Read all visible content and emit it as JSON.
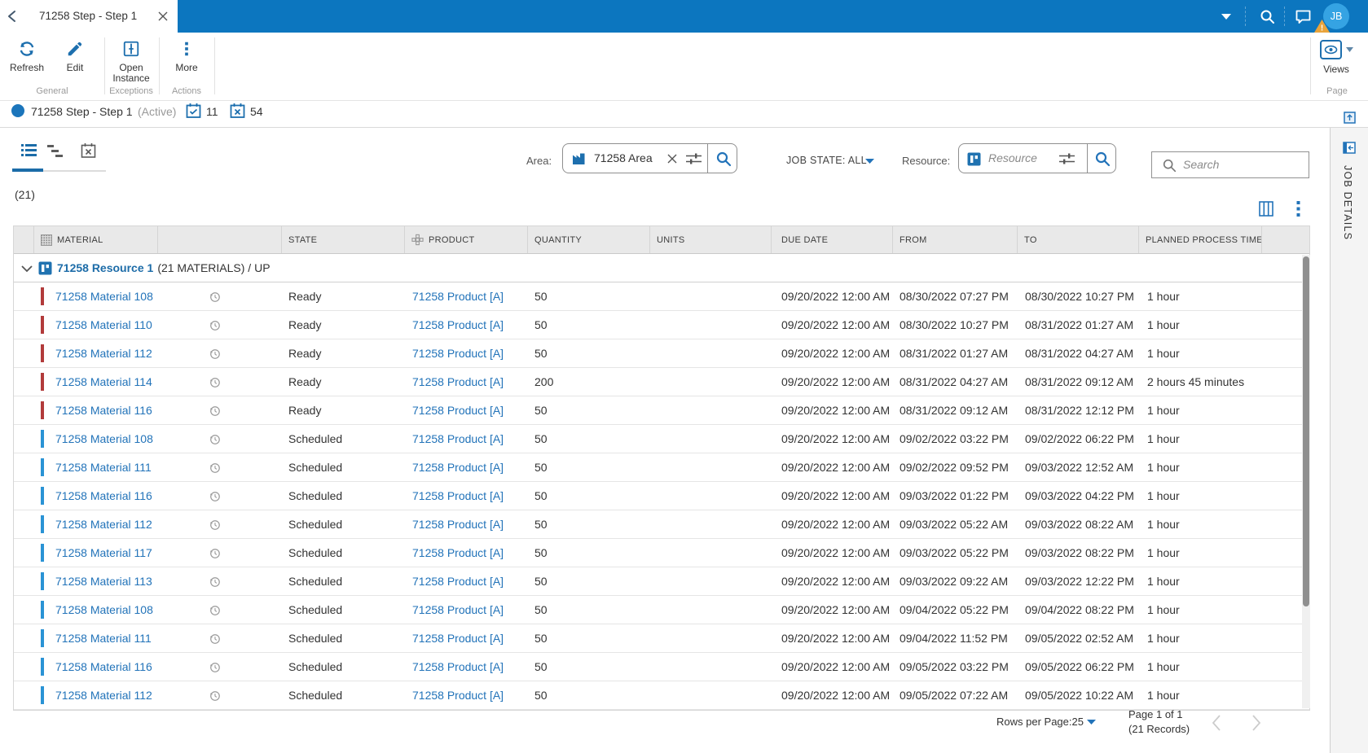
{
  "topbar": {
    "tab_title": "71258 Step - Step 1",
    "avatar_initials": "JB"
  },
  "ribbon": {
    "refresh_label": "Refresh",
    "edit_label": "Edit",
    "open_instance_label": "Open Instance",
    "more_label": "More",
    "views_label": "Views",
    "groups": {
      "general": "General",
      "exceptions": "Exceptions",
      "actions": "Actions",
      "page": "Page"
    }
  },
  "statusbar": {
    "title": "71258 Step - Step 1",
    "state": "(Active)",
    "scheduled_count": "11",
    "unscheduled_count": "54"
  },
  "filters": {
    "area_label": "Area:",
    "area_value": "71258 Area",
    "job_state": "JOB STATE: ALL",
    "resource_label": "Resource:",
    "resource_placeholder": "Resource",
    "search_placeholder": "Search"
  },
  "grid": {
    "count": "(21)",
    "columns": [
      "",
      "MATERIAL",
      "",
      "STATE",
      "PRODUCT",
      "QUANTITY",
      "UNITS",
      "DUE DATE",
      "FROM",
      "TO",
      "PLANNED PROCESS TIME",
      ""
    ],
    "group": {
      "name": "71258 Resource 1",
      "suffix": "(21 MATERIALS) / UP"
    },
    "rows": [
      {
        "material": "71258 Material 108",
        "state": "Ready",
        "product": "71258 Product [A]",
        "quantity": "50",
        "units": "",
        "due": "09/20/2022 12:00 AM",
        "from": "08/30/2022 07:27 PM",
        "to": "08/30/2022 10:27 PM",
        "planned": "1 hour",
        "bar": "red"
      },
      {
        "material": "71258 Material 110",
        "state": "Ready",
        "product": "71258 Product [A]",
        "quantity": "50",
        "units": "",
        "due": "09/20/2022 12:00 AM",
        "from": "08/30/2022 10:27 PM",
        "to": "08/31/2022 01:27 AM",
        "planned": "1 hour",
        "bar": "red"
      },
      {
        "material": "71258 Material 112",
        "state": "Ready",
        "product": "71258 Product [A]",
        "quantity": "50",
        "units": "",
        "due": "09/20/2022 12:00 AM",
        "from": "08/31/2022 01:27 AM",
        "to": "08/31/2022 04:27 AM",
        "planned": "1 hour",
        "bar": "red"
      },
      {
        "material": "71258 Material 114",
        "state": "Ready",
        "product": "71258 Product [A]",
        "quantity": "200",
        "units": "",
        "due": "09/20/2022 12:00 AM",
        "from": "08/31/2022 04:27 AM",
        "to": "08/31/2022 09:12 AM",
        "planned": "2 hours 45 minutes",
        "bar": "red"
      },
      {
        "material": "71258 Material 116",
        "state": "Ready",
        "product": "71258 Product [A]",
        "quantity": "50",
        "units": "",
        "due": "09/20/2022 12:00 AM",
        "from": "08/31/2022 09:12 AM",
        "to": "08/31/2022 12:12 PM",
        "planned": "1 hour",
        "bar": "red"
      },
      {
        "material": "71258 Material 108",
        "state": "Scheduled",
        "product": "71258 Product [A]",
        "quantity": "50",
        "units": "",
        "due": "09/20/2022 12:00 AM",
        "from": "09/02/2022 03:22 PM",
        "to": "09/02/2022 06:22 PM",
        "planned": "1 hour",
        "bar": "blue"
      },
      {
        "material": "71258 Material 111",
        "state": "Scheduled",
        "product": "71258 Product [A]",
        "quantity": "50",
        "units": "",
        "due": "09/20/2022 12:00 AM",
        "from": "09/02/2022 09:52 PM",
        "to": "09/03/2022 12:52 AM",
        "planned": "1 hour",
        "bar": "blue"
      },
      {
        "material": "71258 Material 116",
        "state": "Scheduled",
        "product": "71258 Product [A]",
        "quantity": "50",
        "units": "",
        "due": "09/20/2022 12:00 AM",
        "from": "09/03/2022 01:22 PM",
        "to": "09/03/2022 04:22 PM",
        "planned": "1 hour",
        "bar": "blue"
      },
      {
        "material": "71258 Material 112",
        "state": "Scheduled",
        "product": "71258 Product [A]",
        "quantity": "50",
        "units": "",
        "due": "09/20/2022 12:00 AM",
        "from": "09/03/2022 05:22 AM",
        "to": "09/03/2022 08:22 AM",
        "planned": "1 hour",
        "bar": "blue"
      },
      {
        "material": "71258 Material 117",
        "state": "Scheduled",
        "product": "71258 Product [A]",
        "quantity": "50",
        "units": "",
        "due": "09/20/2022 12:00 AM",
        "from": "09/03/2022 05:22 PM",
        "to": "09/03/2022 08:22 PM",
        "planned": "1 hour",
        "bar": "blue"
      },
      {
        "material": "71258 Material 113",
        "state": "Scheduled",
        "product": "71258 Product [A]",
        "quantity": "50",
        "units": "",
        "due": "09/20/2022 12:00 AM",
        "from": "09/03/2022 09:22 AM",
        "to": "09/03/2022 12:22 PM",
        "planned": "1 hour",
        "bar": "blue"
      },
      {
        "material": "71258 Material 108",
        "state": "Scheduled",
        "product": "71258 Product [A]",
        "quantity": "50",
        "units": "",
        "due": "09/20/2022 12:00 AM",
        "from": "09/04/2022 05:22 PM",
        "to": "09/04/2022 08:22 PM",
        "planned": "1 hour",
        "bar": "blue"
      },
      {
        "material": "71258 Material 111",
        "state": "Scheduled",
        "product": "71258 Product [A]",
        "quantity": "50",
        "units": "",
        "due": "09/20/2022 12:00 AM",
        "from": "09/04/2022 11:52 PM",
        "to": "09/05/2022 02:52 AM",
        "planned": "1 hour",
        "bar": "blue"
      },
      {
        "material": "71258 Material 116",
        "state": "Scheduled",
        "product": "71258 Product [A]",
        "quantity": "50",
        "units": "",
        "due": "09/20/2022 12:00 AM",
        "from": "09/05/2022 03:22 PM",
        "to": "09/05/2022 06:22 PM",
        "planned": "1 hour",
        "bar": "blue"
      },
      {
        "material": "71258 Material 112",
        "state": "Scheduled",
        "product": "71258 Product [A]",
        "quantity": "50",
        "units": "",
        "due": "09/20/2022 12:00 AM",
        "from": "09/05/2022 07:22 AM",
        "to": "09/05/2022 10:22 AM",
        "planned": "1 hour",
        "bar": "blue"
      }
    ],
    "footer": {
      "rows_per_page": "Rows per Page:25",
      "page": "Page 1 of 1",
      "records": "(21 Records)"
    }
  },
  "panel": {
    "title": "JOB DETAILS"
  },
  "colors": {
    "topbar": "#0c76bf",
    "link": "#2273b9",
    "icon_blue": "#1d6fae",
    "ready_bar": "#b23b3b",
    "scheduled_bar": "#2a93d5"
  }
}
